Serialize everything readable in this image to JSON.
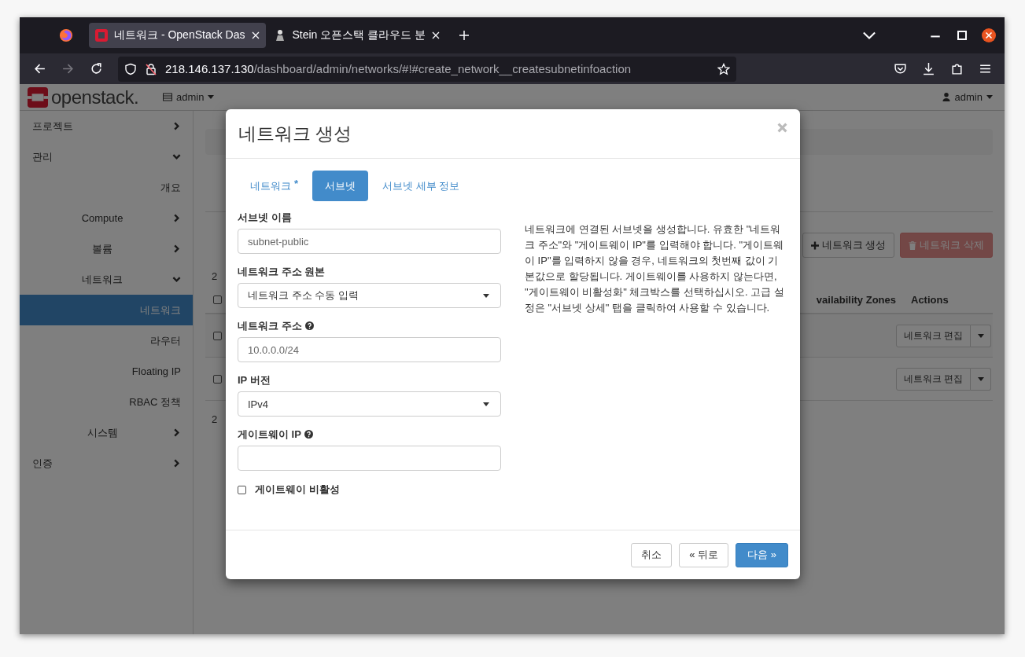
{
  "browser": {
    "tabs": [
      {
        "title": "네트워크 - OpenStack Das",
        "kind": "openstack",
        "selected": true
      },
      {
        "title": "Stein 오픈스택 클라우드 분",
        "kind": "blog",
        "selected": false
      }
    ],
    "url": {
      "host": "218.146.137.130",
      "path": "/dashboard/admin/networks/#!#create_network__createsubnetinfoaction"
    }
  },
  "header": {
    "logo": "openstack.",
    "project": "admin",
    "user": "admin"
  },
  "sidebar": {
    "items": [
      {
        "label": "프로젝트",
        "kind": "group",
        "expanded": false
      },
      {
        "label": "관리",
        "kind": "group",
        "expanded": true,
        "children": [
          {
            "label": "개요",
            "kind": "link",
            "selected": false
          },
          {
            "label": "Compute",
            "kind": "group",
            "expanded": false
          },
          {
            "label": "볼륨",
            "kind": "group",
            "expanded": false
          },
          {
            "label": "네트워크",
            "kind": "group",
            "expanded": true,
            "children": [
              {
                "label": "네트워크",
                "kind": "link",
                "selected": true
              },
              {
                "label": "라우터",
                "kind": "link",
                "selected": false
              },
              {
                "label": "Floating IP",
                "kind": "link",
                "selected": false
              },
              {
                "label": "RBAC 정책",
                "kind": "link",
                "selected": false
              }
            ]
          },
          {
            "label": "시스템",
            "kind": "group",
            "expanded": false
          }
        ]
      },
      {
        "label": "인증",
        "kind": "group",
        "expanded": false
      }
    ]
  },
  "content": {
    "item_count": "2",
    "buttons": [
      {
        "label": "네트워크 생성",
        "kind": "create",
        "disabled": false
      },
      {
        "label": "네트워크 삭제",
        "kind": "delete",
        "disabled": true
      }
    ],
    "table": {
      "select_all_checked": false,
      "columns": [
        "vailability Zones",
        "Actions"
      ],
      "rows": [
        {
          "checked": false,
          "action": "네트워크 편집"
        },
        {
          "checked": false,
          "action": "네트워크 편집"
        }
      ]
    },
    "footer_count": "2"
  },
  "modal": {
    "title": "네트워크 생성",
    "tabs": [
      {
        "label": "네트워크",
        "required_mark": "*",
        "selected": false
      },
      {
        "label": "서브넷",
        "selected": true
      },
      {
        "label": "서브넷 세부 정보",
        "selected": false
      }
    ],
    "fields": [
      {
        "kind": "text",
        "label": "서브넷 이름",
        "help": false,
        "value": "subnet-public"
      },
      {
        "kind": "select",
        "label": "네트워크 주소 원본",
        "help": false,
        "value": "네트워크 주소 수동 입력"
      },
      {
        "kind": "text",
        "label": "네트워크 주소",
        "help": true,
        "value": "10.0.0.0/24"
      },
      {
        "kind": "select",
        "label": "IP 버전",
        "help": false,
        "value": "IPv4"
      },
      {
        "kind": "text",
        "label": "게이트웨이 IP",
        "help": true
      },
      {
        "kind": "checkbox",
        "label": "게이트웨이 비활성",
        "checked": false
      }
    ],
    "description": "네트워크에 연결된 서브넷을 생성합니다. 유효한 \"네트워크 주소\"와 \"게이트웨이 IP\"를 입력해야 합니다. \"게이트웨이 IP\"를 입력하지 않을 경우, 네트워크의 첫번째 값이 기본값으로 할당됩니다. 게이트웨이를 사용하지 않는다면, \"게이트웨이 비활성화\" 체크박스를 선택하십시오. 고급 설정은 \"서브넷 상세\" 탭을 클릭하여 사용할 수 있습니다.",
    "buttons": [
      {
        "label": "취소",
        "kind": "default"
      },
      {
        "label": "« 뒤로",
        "kind": "default"
      },
      {
        "label": "다음 »",
        "kind": "primary"
      }
    ]
  }
}
